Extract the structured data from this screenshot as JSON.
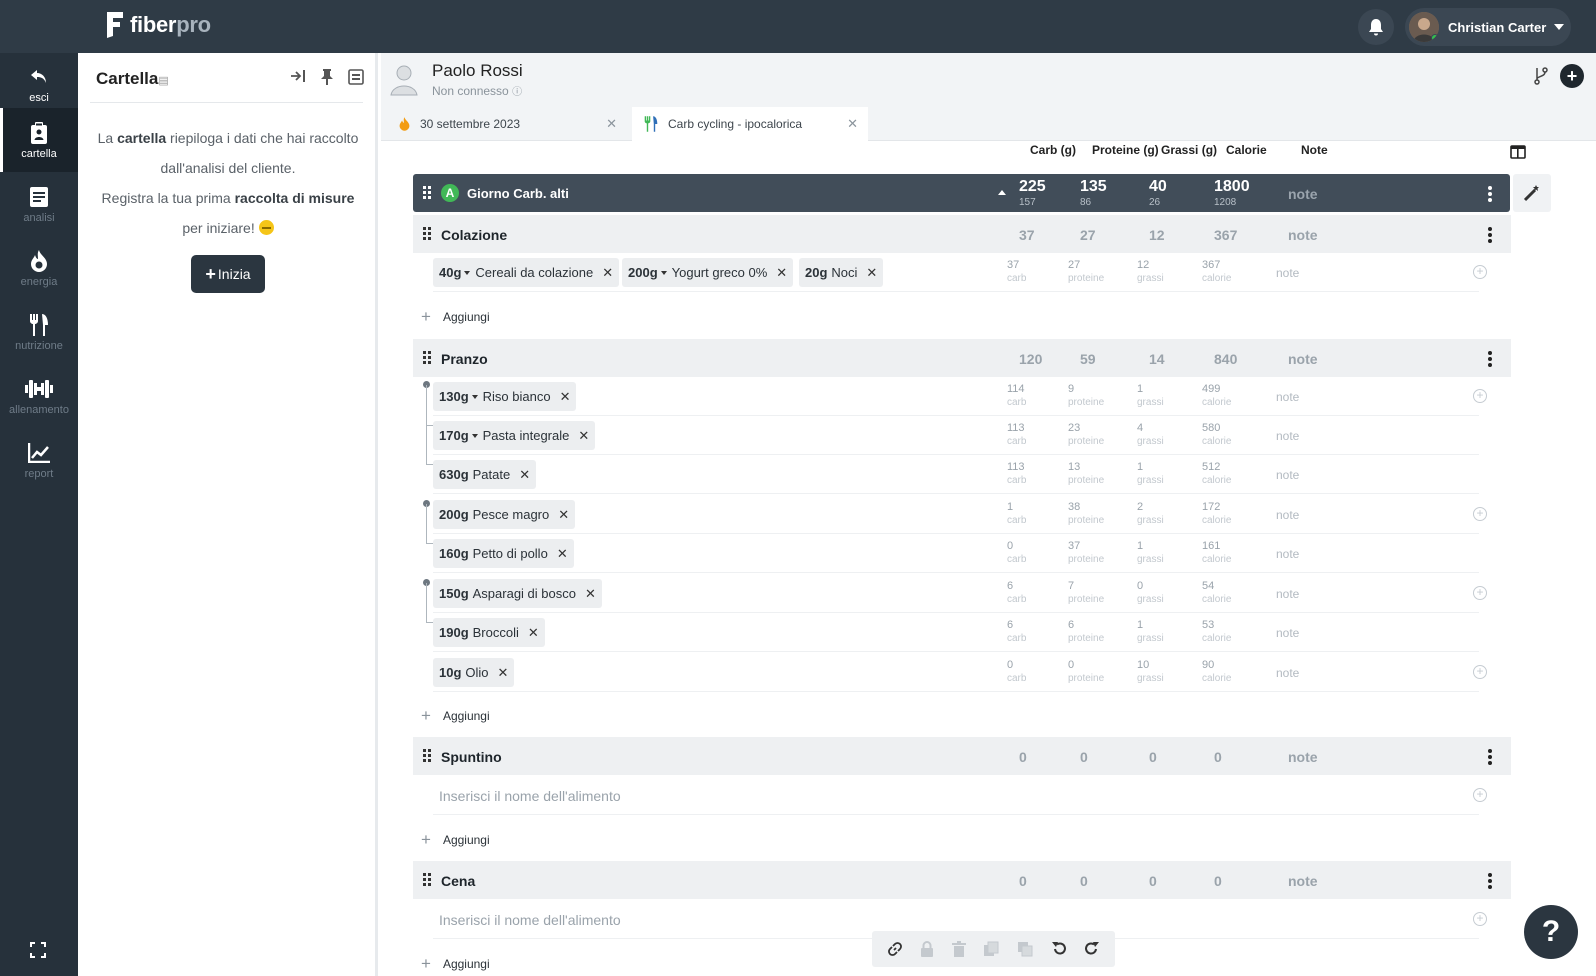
{
  "app": {
    "brand_a": "fiber",
    "brand_b": "pro",
    "user_name": "Christian Carter",
    "colors": {
      "topbar": "#2f3b46",
      "nav": "#26313b",
      "accent_green": "#41b857",
      "day_row": "#414d59"
    }
  },
  "nav": {
    "exit": "esci",
    "items": [
      "cartella",
      "analisi",
      "energia",
      "nutrizione",
      "allenamento",
      "report"
    ],
    "icons": [
      "clipboard-icon",
      "document-icon",
      "flame-icon",
      "cutlery-icon",
      "dumbbell-icon",
      "chart-icon"
    ]
  },
  "panel": {
    "title": "Cartella",
    "line1_a": "La ",
    "line1_b": "cartella",
    "line1_c": " riepiloga i dati che hai raccolto",
    "line2": "dall'analisi del cliente.",
    "line3_a": "Registra la tua prima ",
    "line3_b": "raccolta di misure",
    "line4": "per iniziare! ",
    "start_button": "Inizia"
  },
  "client": {
    "name": "Paolo Rossi",
    "status": "Non connesso"
  },
  "tabs": [
    {
      "label": "30 settembre 2023",
      "icon": "flame-icon"
    },
    {
      "label": "Carb cycling - ipocalorica",
      "icon": "cutlery-icon"
    }
  ],
  "columns": {
    "carb": "Carb (g)",
    "protein": "Proteine (g)",
    "fat": "Grassi (g)",
    "cal": "Calorie",
    "note": "Note"
  },
  "day": {
    "badge": "A",
    "name": "Giorno Carb. alti",
    "carb": "225",
    "carb_sub": "157",
    "protein": "135",
    "protein_sub": "86",
    "fat": "40",
    "fat_sub": "26",
    "cal": "1800",
    "cal_sub": "1208",
    "note": "note"
  },
  "labels": {
    "carb": "carb",
    "protein": "proteine",
    "fat": "grassi",
    "cal": "calorie",
    "note": "note",
    "add": "Aggiungi",
    "placeholder": "Inserisci il nome dell'alimento"
  },
  "meals": {
    "colazione": {
      "name": "Colazione",
      "carb": "37",
      "protein": "27",
      "fat": "12",
      "cal": "367",
      "row": {
        "carb": "37",
        "protein": "27",
        "fat": "12",
        "cal": "367"
      },
      "foods": [
        {
          "qty": "40g",
          "name": "Cereali da colazione"
        },
        {
          "qty": "200g",
          "name": "Yogurt greco 0%"
        },
        {
          "qty": "20g",
          "name": "Noci"
        }
      ]
    },
    "pranzo": {
      "name": "Pranzo",
      "carb": "120",
      "protein": "59",
      "fat": "14",
      "cal": "840",
      "foods": [
        {
          "qty": "130g",
          "name": "Riso bianco",
          "carb": "114",
          "protein": "9",
          "fat": "1",
          "cal": "499"
        },
        {
          "qty": "170g",
          "name": "Pasta integrale",
          "carb": "113",
          "protein": "23",
          "fat": "4",
          "cal": "580"
        },
        {
          "qty": "630g",
          "name": "Patate",
          "carb": "113",
          "protein": "13",
          "fat": "1",
          "cal": "512"
        },
        {
          "qty": "200g",
          "name": "Pesce magro",
          "carb": "1",
          "protein": "38",
          "fat": "2",
          "cal": "172"
        },
        {
          "qty": "160g",
          "name": "Petto di pollo",
          "carb": "0",
          "protein": "37",
          "fat": "1",
          "cal": "161"
        },
        {
          "qty": "150g",
          "name": "Asparagi di bosco",
          "carb": "6",
          "protein": "7",
          "fat": "0",
          "cal": "54"
        },
        {
          "qty": "190g",
          "name": "Broccoli",
          "carb": "6",
          "protein": "6",
          "fat": "1",
          "cal": "53"
        },
        {
          "qty": "10g",
          "name": "Olio",
          "carb": "0",
          "protein": "0",
          "fat": "10",
          "cal": "90"
        }
      ]
    },
    "spuntino": {
      "name": "Spuntino",
      "carb": "0",
      "protein": "0",
      "fat": "0",
      "cal": "0"
    },
    "cena": {
      "name": "Cena",
      "carb": "0",
      "protein": "0",
      "fat": "0",
      "cal": "0"
    }
  },
  "help": "?"
}
